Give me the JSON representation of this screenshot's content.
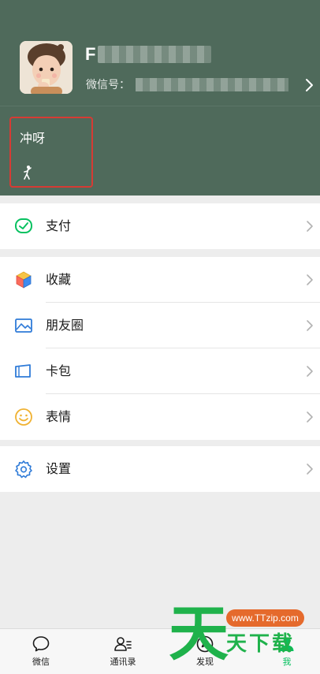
{
  "profile": {
    "name_initial": "F",
    "wechat_id_label": "微信号：",
    "status_text": "冲呀"
  },
  "menu": {
    "pay": {
      "label": "支付",
      "icon": "pay-check-icon",
      "color": "#07c160"
    },
    "favorites": {
      "label": "收藏",
      "icon": "cube-icon"
    },
    "moments": {
      "label": "朋友圈",
      "icon": "picture-icon",
      "color": "#2f7bd8"
    },
    "cards": {
      "label": "卡包",
      "icon": "card-icon",
      "color": "#2f7bd8"
    },
    "stickers": {
      "label": "表情",
      "icon": "smiley-icon",
      "color": "#f0b232"
    },
    "settings": {
      "label": "设置",
      "icon": "gear-icon",
      "color": "#2f7bd8"
    }
  },
  "tabbar": {
    "tabs": [
      {
        "label": "微信",
        "icon": "chat-bubble-icon"
      },
      {
        "label": "通讯录",
        "icon": "contacts-icon"
      },
      {
        "label": "发现",
        "icon": "compass-icon"
      },
      {
        "label": "我",
        "icon": "person-icon",
        "active": true
      }
    ]
  },
  "watermark": {
    "url": "www.TTzip.com",
    "text": "天下载",
    "big_char": "天",
    "green": "#1fb24b",
    "orange": "#e56a2c"
  },
  "theme": {
    "header_bg": "#4f6a5b",
    "accent": "#07c160",
    "highlight_border": "#d63b34"
  }
}
